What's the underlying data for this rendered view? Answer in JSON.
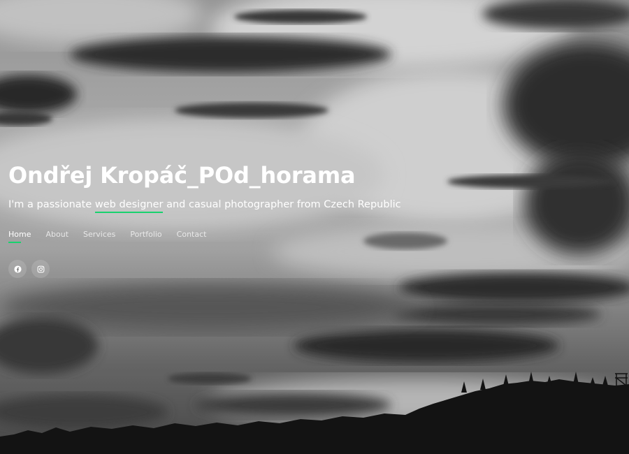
{
  "hero": {
    "title": "Ondřej Kropáč_POd_horama",
    "subtitle": {
      "before": "I'm a passionate ",
      "highlight": "web designer",
      "after": " and casual photographer from Czech Republic"
    }
  },
  "nav": {
    "items": [
      {
        "label": "Home",
        "active": true
      },
      {
        "label": "About",
        "active": false
      },
      {
        "label": "Services",
        "active": false
      },
      {
        "label": "Portfolio",
        "active": false
      },
      {
        "label": "Contact",
        "active": false
      }
    ]
  },
  "social": [
    {
      "icon": "facebook-icon"
    },
    {
      "icon": "instagram-icon"
    }
  ],
  "theme": {
    "accent": "#18d26e",
    "text": "#ffffff"
  },
  "background": {
    "icon": "black-and-white-sky-photo"
  }
}
